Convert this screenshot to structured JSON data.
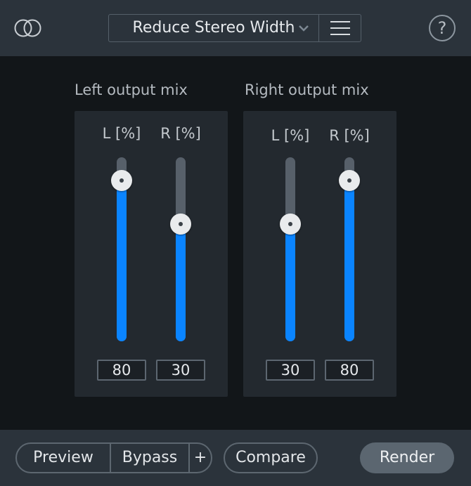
{
  "header": {
    "logo_icon": "overlapping-circles-icon",
    "preset_name": "Reduce Stereo Width",
    "dropdown_icon": "chevron-down-icon",
    "menu_icon": "hamburger-icon",
    "help_label": "?"
  },
  "left_mix": {
    "title": "Left output mix",
    "l_label": "L [%]",
    "r_label": "R [%]",
    "l_value": "80",
    "r_value": "30"
  },
  "right_mix": {
    "title": "Right output mix",
    "l_label": "L [%]",
    "r_label": "R [%]",
    "l_value": "30",
    "r_value": "80"
  },
  "footer": {
    "preview_label": "Preview",
    "bypass_label": "Bypass",
    "plus_label": "+",
    "compare_label": "Compare",
    "render_label": "Render"
  },
  "colors": {
    "accent": "#0a84ff",
    "bar_background": "#2b333b",
    "panel": "#23292f"
  }
}
